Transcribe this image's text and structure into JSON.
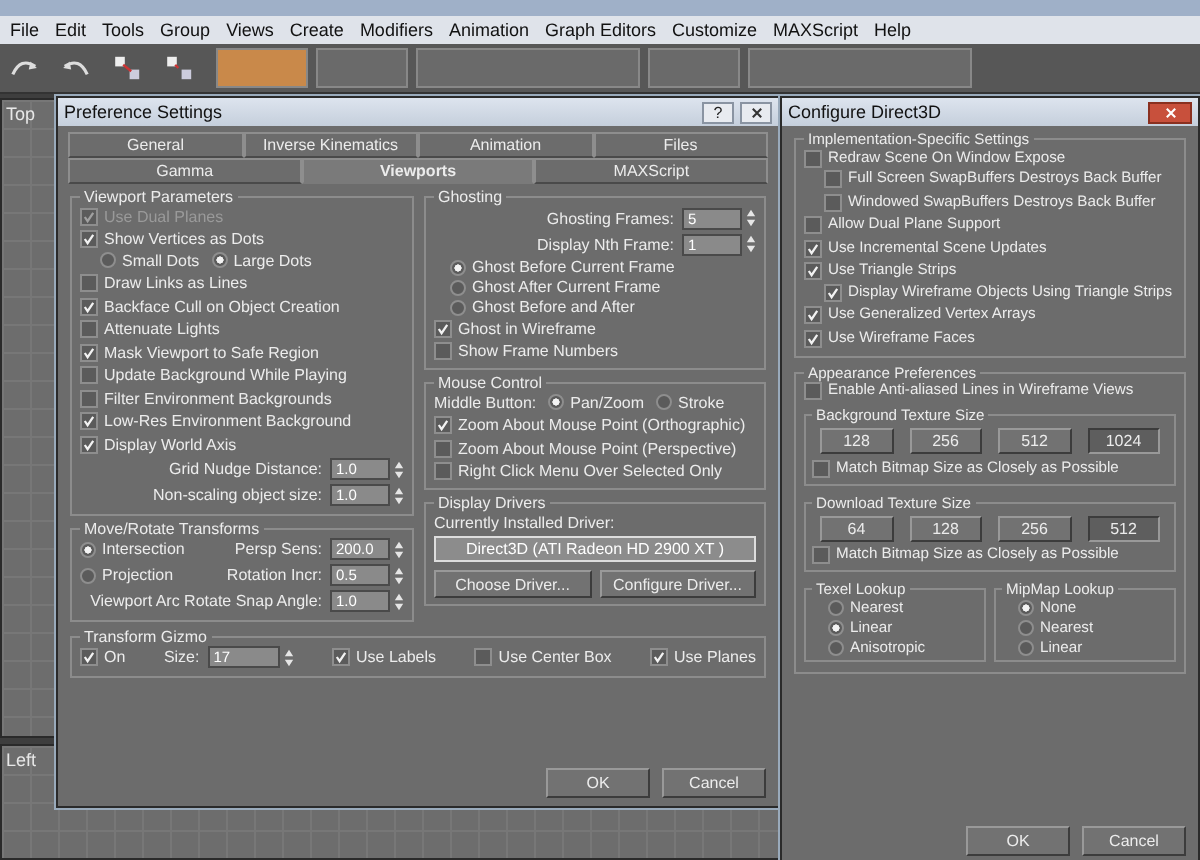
{
  "menu": [
    "File",
    "Edit",
    "Tools",
    "Group",
    "Views",
    "Create",
    "Modifiers",
    "Animation",
    "Graph Editors",
    "Customize",
    "MAXScript",
    "Help"
  ],
  "viewports": [
    {
      "label": "Top"
    },
    {
      "label": "Left"
    }
  ],
  "preferences": {
    "title": "Preference Settings",
    "help_button": "?",
    "tab_rows": [
      [
        {
          "label": "General",
          "selected": false
        },
        {
          "label": "Inverse Kinematics",
          "selected": false
        },
        {
          "label": "Animation",
          "selected": false
        },
        {
          "label": "Files",
          "selected": false
        }
      ],
      [
        {
          "label": "Gamma",
          "selected": false
        },
        {
          "label": "Viewports",
          "selected": true
        },
        {
          "label": "MAXScript",
          "selected": false
        }
      ]
    ],
    "left_groups": [
      {
        "title": "Viewport Parameters",
        "items": [
          {
            "kind": "checkbox",
            "label": "Use Dual Planes",
            "checked": true,
            "disabled": true
          },
          {
            "kind": "checkbox",
            "label": "Show Vertices as Dots",
            "checked": true,
            "disabled": false,
            "children": [
              {
                "kind": "radio_row",
                "options": [
                  {
                    "label": "Small Dots",
                    "selected": false
                  },
                  {
                    "label": "Large Dots",
                    "selected": true
                  }
                ]
              }
            ]
          },
          {
            "kind": "checkbox",
            "label": "Draw Links as Lines",
            "checked": false,
            "disabled": false
          },
          {
            "kind": "checkbox",
            "label": "Backface Cull on Object Creation",
            "checked": true,
            "disabled": false
          },
          {
            "kind": "checkbox",
            "label": "Attenuate Lights",
            "checked": false,
            "disabled": false
          },
          {
            "kind": "checkbox",
            "label": "Mask Viewport to Safe Region",
            "checked": true,
            "disabled": false
          },
          {
            "kind": "checkbox",
            "label": "Update Background While Playing",
            "checked": false,
            "disabled": false
          },
          {
            "kind": "checkbox",
            "label": "Filter Environment Backgrounds",
            "checked": false,
            "disabled": false
          },
          {
            "kind": "checkbox",
            "label": "Low-Res Environment Background",
            "checked": true,
            "disabled": false
          },
          {
            "kind": "checkbox",
            "label": "Display World Axis",
            "checked": true,
            "disabled": false
          },
          {
            "kind": "spinner",
            "label": "Grid Nudge Distance:",
            "value": "1.0"
          },
          {
            "kind": "spinner",
            "label": "Non-scaling object size:",
            "value": "1.0"
          }
        ]
      },
      {
        "title": "Move/Rotate Transforms",
        "items": [
          {
            "kind": "row",
            "items": [
              {
                "kind": "radio",
                "label": "Intersection",
                "selected": true
              },
              {
                "kind": "spinner",
                "label": "Persp Sens:",
                "value": "200.0"
              }
            ]
          },
          {
            "kind": "row",
            "items": [
              {
                "kind": "radio",
                "label": "Projection",
                "selected": false
              },
              {
                "kind": "spinner",
                "label": "Rotation Incr:",
                "value": "0.5"
              }
            ]
          },
          {
            "kind": "spinner",
            "label": "Viewport Arc Rotate Snap Angle:",
            "value": "1.0"
          }
        ]
      }
    ],
    "right_groups": [
      {
        "title": "Ghosting",
        "items": [
          {
            "kind": "spinner",
            "label": "Ghosting Frames:",
            "value": "5"
          },
          {
            "kind": "spinner",
            "label": "Display Nth Frame:",
            "value": "1"
          },
          {
            "kind": "radio_list",
            "options": [
              {
                "label": "Ghost Before Current Frame",
                "selected": true
              },
              {
                "label": "Ghost After Current Frame",
                "selected": false
              },
              {
                "label": "Ghost Before and After",
                "selected": false
              }
            ]
          },
          {
            "kind": "checkbox",
            "label": "Ghost in Wireframe",
            "checked": true
          },
          {
            "kind": "checkbox",
            "label": "Show Frame Numbers",
            "checked": false
          }
        ]
      },
      {
        "title": "Mouse Control",
        "items": [
          {
            "kind": "radio_row",
            "label": "Middle Button:",
            "options": [
              {
                "label": "Pan/Zoom",
                "selected": true
              },
              {
                "label": "Stroke",
                "selected": false
              }
            ]
          },
          {
            "kind": "checkbox",
            "label": "Zoom About Mouse Point (Orthographic)",
            "checked": true
          },
          {
            "kind": "checkbox",
            "label": "Zoom About Mouse Point (Perspective)",
            "checked": false
          },
          {
            "kind": "checkbox",
            "label": "Right Click Menu Over Selected Only",
            "checked": false
          }
        ]
      },
      {
        "title": "Display Drivers",
        "items": [
          {
            "kind": "text",
            "text": "Currently Installed Driver:"
          },
          {
            "kind": "field",
            "value": "Direct3D (ATI Radeon HD 2900 XT )"
          },
          {
            "kind": "buttons",
            "buttons": [
              "Choose Driver...",
              "Configure Driver..."
            ]
          }
        ]
      }
    ],
    "bottom_groups": [
      {
        "title": "Transform Gizmo",
        "items": [
          {
            "kind": "row",
            "items": [
              {
                "kind": "checkbox",
                "label": "On",
                "checked": true
              },
              {
                "kind": "spinner",
                "label": "Size:",
                "value": "17"
              },
              {
                "kind": "checkbox",
                "label": "Use Labels",
                "checked": true
              },
              {
                "kind": "checkbox",
                "label": "Use Center Box",
                "checked": false
              },
              {
                "kind": "checkbox",
                "label": "Use Planes",
                "checked": true
              }
            ]
          }
        ]
      }
    ],
    "buttons": [
      "OK",
      "Cancel"
    ]
  },
  "direct3d": {
    "title": "Configure Direct3D",
    "groups": [
      {
        "title": "Implementation-Specific Settings",
        "items": [
          {
            "kind": "checkbox",
            "label": "Redraw Scene On Window Expose",
            "checked": false,
            "children": [
              {
                "kind": "checkbox",
                "label": "Full Screen SwapBuffers Destroys Back Buffer",
                "checked": false
              },
              {
                "kind": "checkbox",
                "label": "Windowed SwapBuffers Destroys Back Buffer",
                "checked": false
              }
            ]
          },
          {
            "kind": "checkbox",
            "label": "Allow Dual Plane Support",
            "checked": false
          },
          {
            "kind": "checkbox",
            "label": "Use Incremental Scene Updates",
            "checked": true
          },
          {
            "kind": "checkbox",
            "label": "Use Triangle Strips",
            "checked": true,
            "children": [
              {
                "kind": "checkbox",
                "label": "Display Wireframe Objects Using Triangle Strips",
                "checked": true
              }
            ]
          },
          {
            "kind": "checkbox",
            "label": "Use Generalized Vertex Arrays",
            "checked": true
          },
          {
            "kind": "checkbox",
            "label": "Use Wireframe Faces",
            "checked": true
          }
        ]
      },
      {
        "title": "Appearance Preferences",
        "items": [
          {
            "kind": "checkbox",
            "label": "Enable Anti-aliased Lines in Wireframe Views",
            "checked": false
          },
          {
            "kind": "group",
            "title": "Background Texture Size",
            "items": [
              {
                "kind": "size_buttons",
                "options": [
                  {
                    "label": "128",
                    "selected": false
                  },
                  {
                    "label": "256",
                    "selected": false
                  },
                  {
                    "label": "512",
                    "selected": false
                  },
                  {
                    "label": "1024",
                    "selected": true
                  }
                ]
              },
              {
                "kind": "checkbox",
                "label": "Match Bitmap Size as Closely as Possible",
                "checked": false
              }
            ]
          },
          {
            "kind": "group",
            "title": "Download Texture Size",
            "items": [
              {
                "kind": "size_buttons",
                "options": [
                  {
                    "label": "64",
                    "selected": false
                  },
                  {
                    "label": "128",
                    "selected": false
                  },
                  {
                    "label": "256",
                    "selected": false
                  },
                  {
                    "label": "512",
                    "selected": true
                  }
                ]
              },
              {
                "kind": "checkbox",
                "label": "Match Bitmap Size as Closely as Possible",
                "checked": false
              }
            ]
          },
          {
            "kind": "row",
            "items": [
              {
                "kind": "group",
                "title": "Texel Lookup",
                "items": [
                  {
                    "kind": "radio_list",
                    "options": [
                      {
                        "label": "Nearest",
                        "selected": false
                      },
                      {
                        "label": "Linear",
                        "selected": true
                      },
                      {
                        "label": "Anisotropic",
                        "selected": false
                      }
                    ]
                  }
                ]
              },
              {
                "kind": "group",
                "title": "MipMap Lookup",
                "items": [
                  {
                    "kind": "radio_list",
                    "options": [
                      {
                        "label": "None",
                        "selected": true
                      },
                      {
                        "label": "Nearest",
                        "selected": false
                      },
                      {
                        "label": "Linear",
                        "selected": false
                      }
                    ]
                  }
                ]
              }
            ]
          }
        ]
      }
    ],
    "buttons": [
      "OK",
      "Cancel"
    ]
  }
}
